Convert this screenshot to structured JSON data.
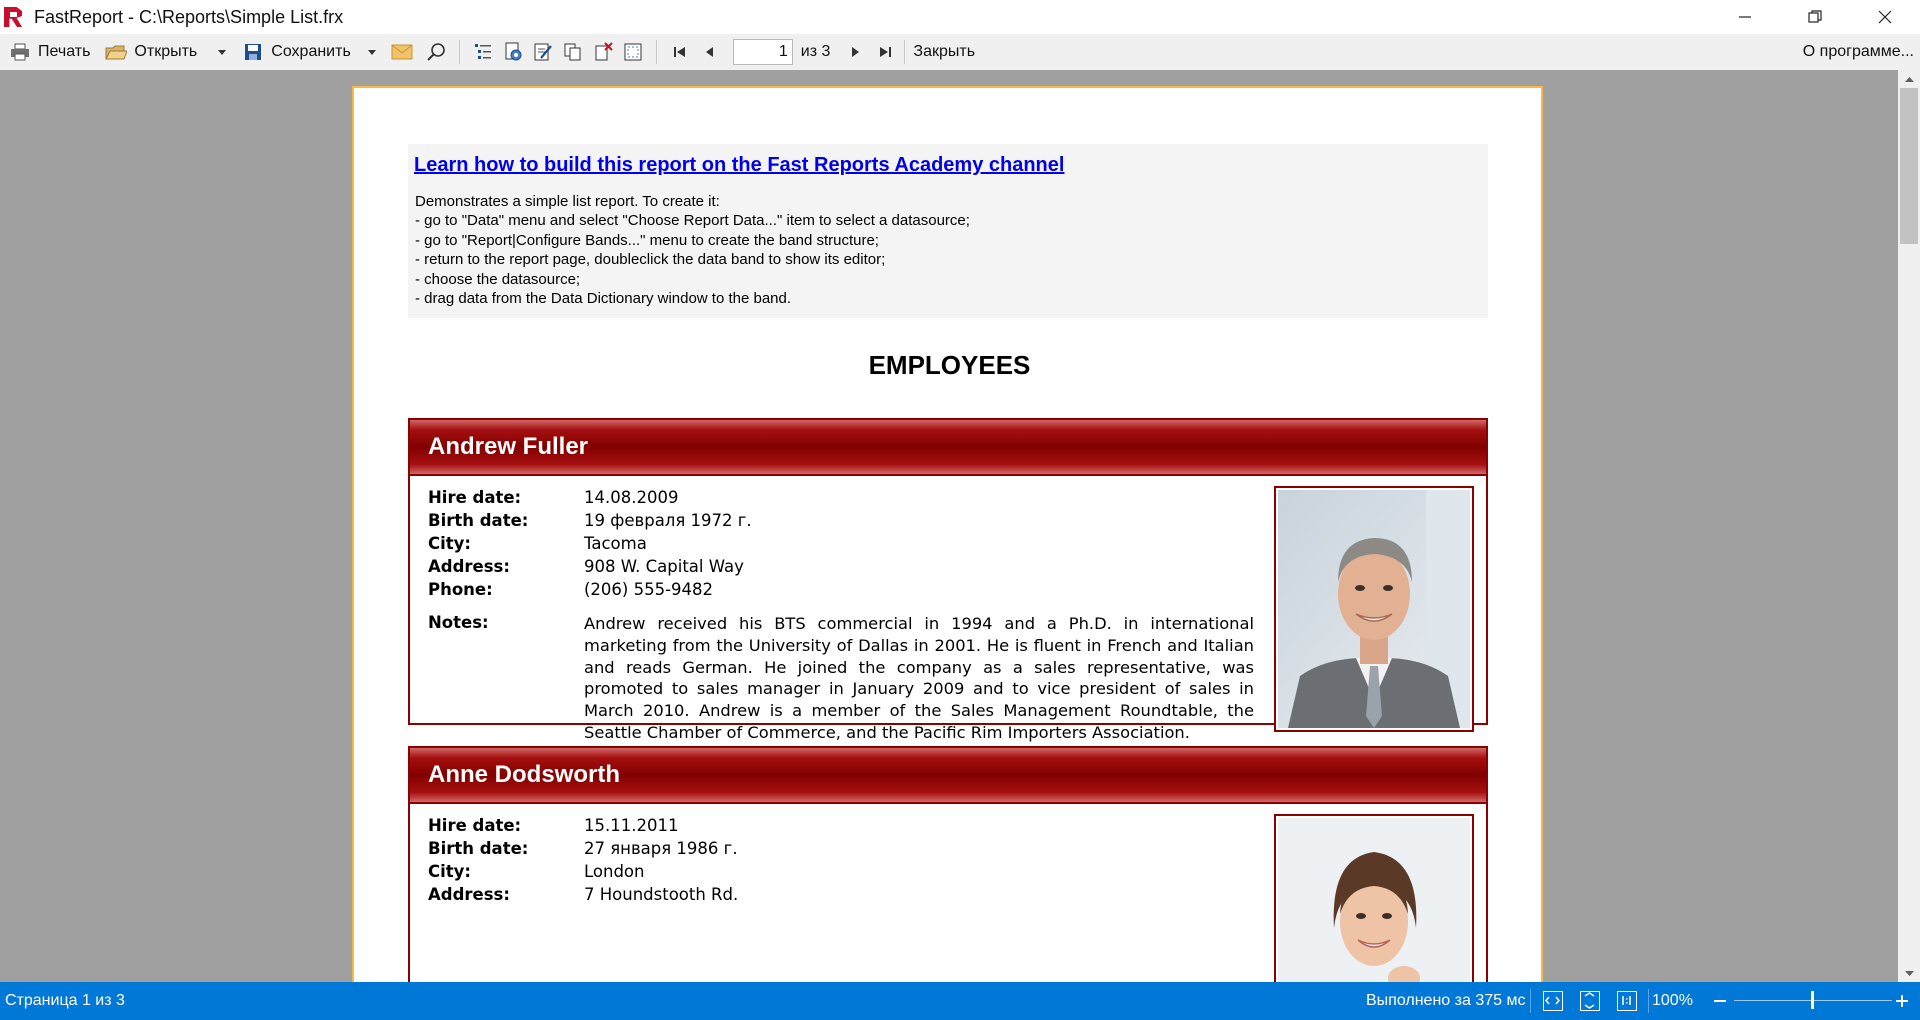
{
  "window": {
    "title": "FastReport - C:\\Reports\\Simple List.frx"
  },
  "toolbar": {
    "print_label": "Печать",
    "open_label": "Открыть",
    "save_label": "Сохранить",
    "page_value": "1",
    "page_of": "из 3",
    "close_label": "Закрыть",
    "about_label": "О программе..."
  },
  "report": {
    "academy_link": "Learn how to build this report on the Fast Reports Academy channel",
    "description_lines": [
      "Demonstrates a simple list report. To create it:",
      "- go to \"Data\" menu and select \"Choose Report Data...\" item to select a datasource;",
      "- go to \"Report|Configure Bands...\" menu to create the band structure;",
      "- return to the report page, doubleclick the data band to show its editor;",
      "- choose the datasource;",
      "- drag data from the Data Dictionary window to the band."
    ],
    "title": "EMPLOYEES",
    "labels": {
      "hire_date": "Hire date:",
      "birth_date": "Birth date:",
      "city": "City:",
      "address": "Address:",
      "phone": "Phone:",
      "notes": "Notes:"
    },
    "employees": [
      {
        "name": "Andrew Fuller",
        "hire_date": "14.08.2009",
        "birth_date": "19 февраля 1972 г.",
        "city": "Tacoma",
        "address": "908 W. Capital Way",
        "phone": "(206) 555-9482",
        "notes": "Andrew received his BTS commercial in 1994 and a Ph.D. in international marketing from the University of Dallas in 2001.  He is fluent in French and Italian and reads German.  He joined the company as a sales representative, was promoted to sales manager in January 2009 and to vice president of sales in March 2010.  Andrew is a member of the Sales Management Roundtable, the Seattle Chamber of Commerce, and the Pacific Rim Importers Association."
      },
      {
        "name": "Anne Dodsworth",
        "hire_date": "15.11.2011",
        "birth_date": "27 января 1986 г.",
        "city": "London",
        "address": "7 Houndstooth Rd."
      }
    ]
  },
  "status": {
    "page_info": "Страница 1 из 3",
    "elapsed": "Выполнено за 375 мс",
    "zoom": "100%",
    "zoom_level_percent": 100
  },
  "colors": {
    "statusbar": "#0078d7",
    "band_header": "#820000",
    "page_border": "#f4b942",
    "link": "#0000ee"
  }
}
